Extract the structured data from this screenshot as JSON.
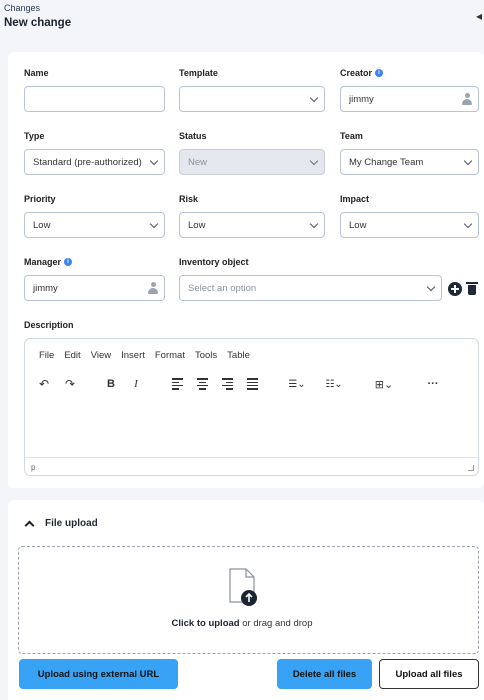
{
  "header": {
    "breadcrumb": "Changes",
    "title": "New change"
  },
  "form": {
    "name": {
      "label": "Name",
      "value": ""
    },
    "template": {
      "label": "Template",
      "value": ""
    },
    "creator": {
      "label": "Creator",
      "value": "jimmy"
    },
    "type": {
      "label": "Type",
      "value": "Standard (pre-authorized)"
    },
    "status": {
      "label": "Status",
      "value": "New"
    },
    "team": {
      "label": "Team",
      "value": "My Change Team"
    },
    "priority": {
      "label": "Priority",
      "value": "Low"
    },
    "risk": {
      "label": "Risk",
      "value": "Low"
    },
    "impact": {
      "label": "Impact",
      "value": "Low"
    },
    "manager": {
      "label": "Manager",
      "value": "jimmy"
    },
    "inventory": {
      "label": "Inventory object",
      "placeholder": "Select an option"
    },
    "description": {
      "label": "Description"
    }
  },
  "editor": {
    "menu": [
      "File",
      "Edit",
      "View",
      "Insert",
      "Format",
      "Tools",
      "Table"
    ],
    "status_path": "p"
  },
  "upload": {
    "title": "File upload",
    "click_text": "Click to upload",
    "drag_text": " or drag and drop",
    "external_url_label": "Upload using external URL",
    "delete_all_label": "Delete all files",
    "upload_all_label": "Upload all files"
  },
  "colors": {
    "accent": "#38a3f4",
    "info": "#3b82f6"
  }
}
